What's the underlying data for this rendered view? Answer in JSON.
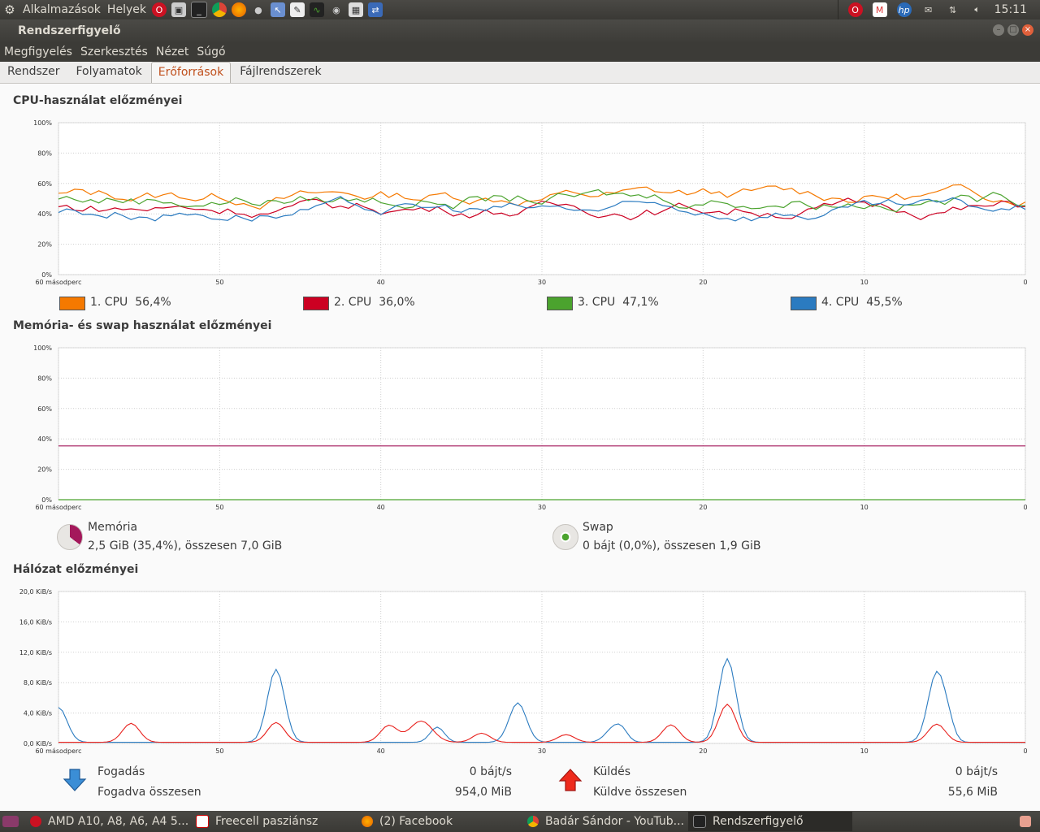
{
  "topbar": {
    "menu_apps": "Alkalmazások",
    "menu_places": "Helyek",
    "clock": "15:11"
  },
  "window": {
    "title": "Rendszerfigyelő"
  },
  "menubar": [
    "Megfigyelés",
    "Szerkesztés",
    "Nézet",
    "Súgó"
  ],
  "tabs": [
    {
      "label": "Rendszer",
      "active": false
    },
    {
      "label": "Folyamatok",
      "active": false
    },
    {
      "label": "Erőforrások",
      "active": true
    },
    {
      "label": "Fájlrendszerek",
      "active": false
    }
  ],
  "cpu": {
    "title": "CPU-használat előzményei",
    "y_ticks": [
      "100%",
      "80%",
      "60%",
      "40%",
      "20%",
      "0%"
    ],
    "x_ticks": [
      "60 másodperc",
      "50",
      "40",
      "30",
      "20",
      "10",
      "0"
    ],
    "legend": [
      {
        "name": "1. CPU",
        "value": "56,4%",
        "color": "#f57900"
      },
      {
        "name": "2. CPU",
        "value": "36,0%",
        "color": "#cc0022"
      },
      {
        "name": "3. CPU",
        "value": "47,1%",
        "color": "#4ba32e"
      },
      {
        "name": "4. CPU",
        "value": "45,5%",
        "color": "#2b7bc0"
      }
    ]
  },
  "memory": {
    "title": "Memória- és swap használat előzményei",
    "y_ticks": [
      "100%",
      "80%",
      "60%",
      "40%",
      "20%",
      "0%"
    ],
    "x_ticks": [
      "60 másodperc",
      "50",
      "40",
      "30",
      "20",
      "10",
      "0"
    ],
    "mem_label": "Memória",
    "mem_value": "2,5 GiB (35,4%), összesen 7,0 GiB",
    "mem_percent": 35.4,
    "mem_color": "#a4185b",
    "swap_label": "Swap",
    "swap_value": "0 bájt (0,0%), összesen 1,9 GiB",
    "swap_percent": 0.0,
    "swap_color": "#4ba32e"
  },
  "network": {
    "title": "Hálózat előzményei",
    "y_ticks": [
      "20,0 KiB/s",
      "16,0 KiB/s",
      "12,0 KiB/s",
      "8,0 KiB/s",
      "4,0 KiB/s",
      "0,0 KiB/s"
    ],
    "x_ticks": [
      "60 másodperc",
      "50",
      "40",
      "30",
      "20",
      "10",
      "0"
    ],
    "recv_label": "Fogadás",
    "recv_rate": "0 bájt/s",
    "recv_total_label": "Fogadva összesen",
    "recv_total": "954,0 MiB",
    "recv_color": "#2b7bc0",
    "send_label": "Küldés",
    "send_rate": "0 bájt/s",
    "send_total_label": "Küldve összesen",
    "send_total": "55,6 MiB",
    "send_color": "#e8211d"
  },
  "taskbar": [
    {
      "label": "AMD A10, A8, A6, A4 5...",
      "active": false
    },
    {
      "label": "Freecell pasziánsz",
      "active": false
    },
    {
      "label": "(2) Facebook",
      "active": false
    },
    {
      "label": "Badár Sándor - YouTub...",
      "active": false
    },
    {
      "label": "Rendszerfigyelő",
      "active": true
    }
  ]
}
